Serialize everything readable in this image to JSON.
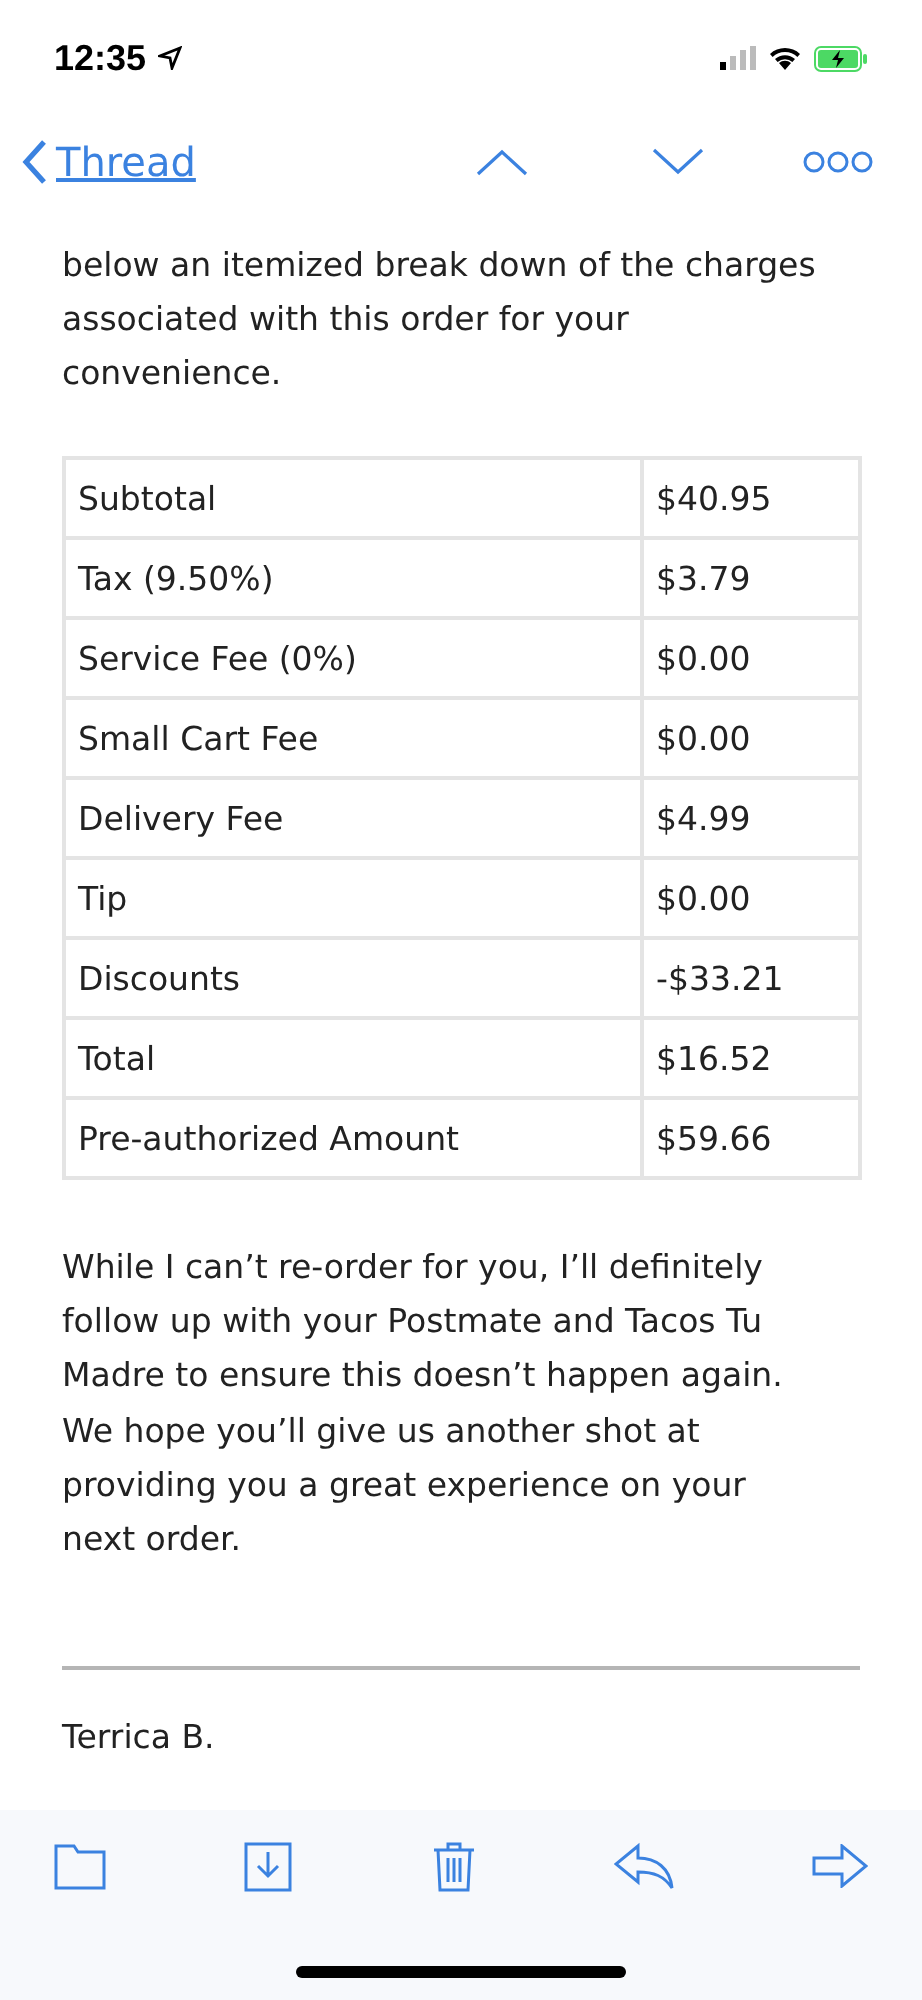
{
  "status_bar": {
    "time": "12:35"
  },
  "nav": {
    "back_label": "Thread"
  },
  "intro_lines": [
    "below an itemized break down of the charges",
    "associated with this order for your",
    "convenience."
  ],
  "charges": [
    {
      "label": "Subtotal",
      "amount": "$40.95"
    },
    {
      "label": "Tax (9.50%)",
      "amount": "$3.79"
    },
    {
      "label": "Service Fee (0%)",
      "amount": "$0.00"
    },
    {
      "label": "Small Cart Fee",
      "amount": "$0.00"
    },
    {
      "label": "Delivery Fee",
      "amount": "$4.99"
    },
    {
      "label": "Tip",
      "amount": "$0.00"
    },
    {
      "label": "Discounts",
      "amount": "-$33.21"
    },
    {
      "label": "Total",
      "amount": "$16.52"
    },
    {
      "label": "Pre-authorized Amount",
      "amount": "$59.66"
    }
  ],
  "closing_lines": [
    "While I can’t re-order for you, I’ll definitely",
    "follow up with your Postmate and Tacos Tu",
    "Madre to ensure this doesn’t happen again.",
    "We hope you’ll give us another shot at",
    "providing you a great experience on your",
    "next order."
  ],
  "signature": {
    "name": "Terrica B."
  }
}
